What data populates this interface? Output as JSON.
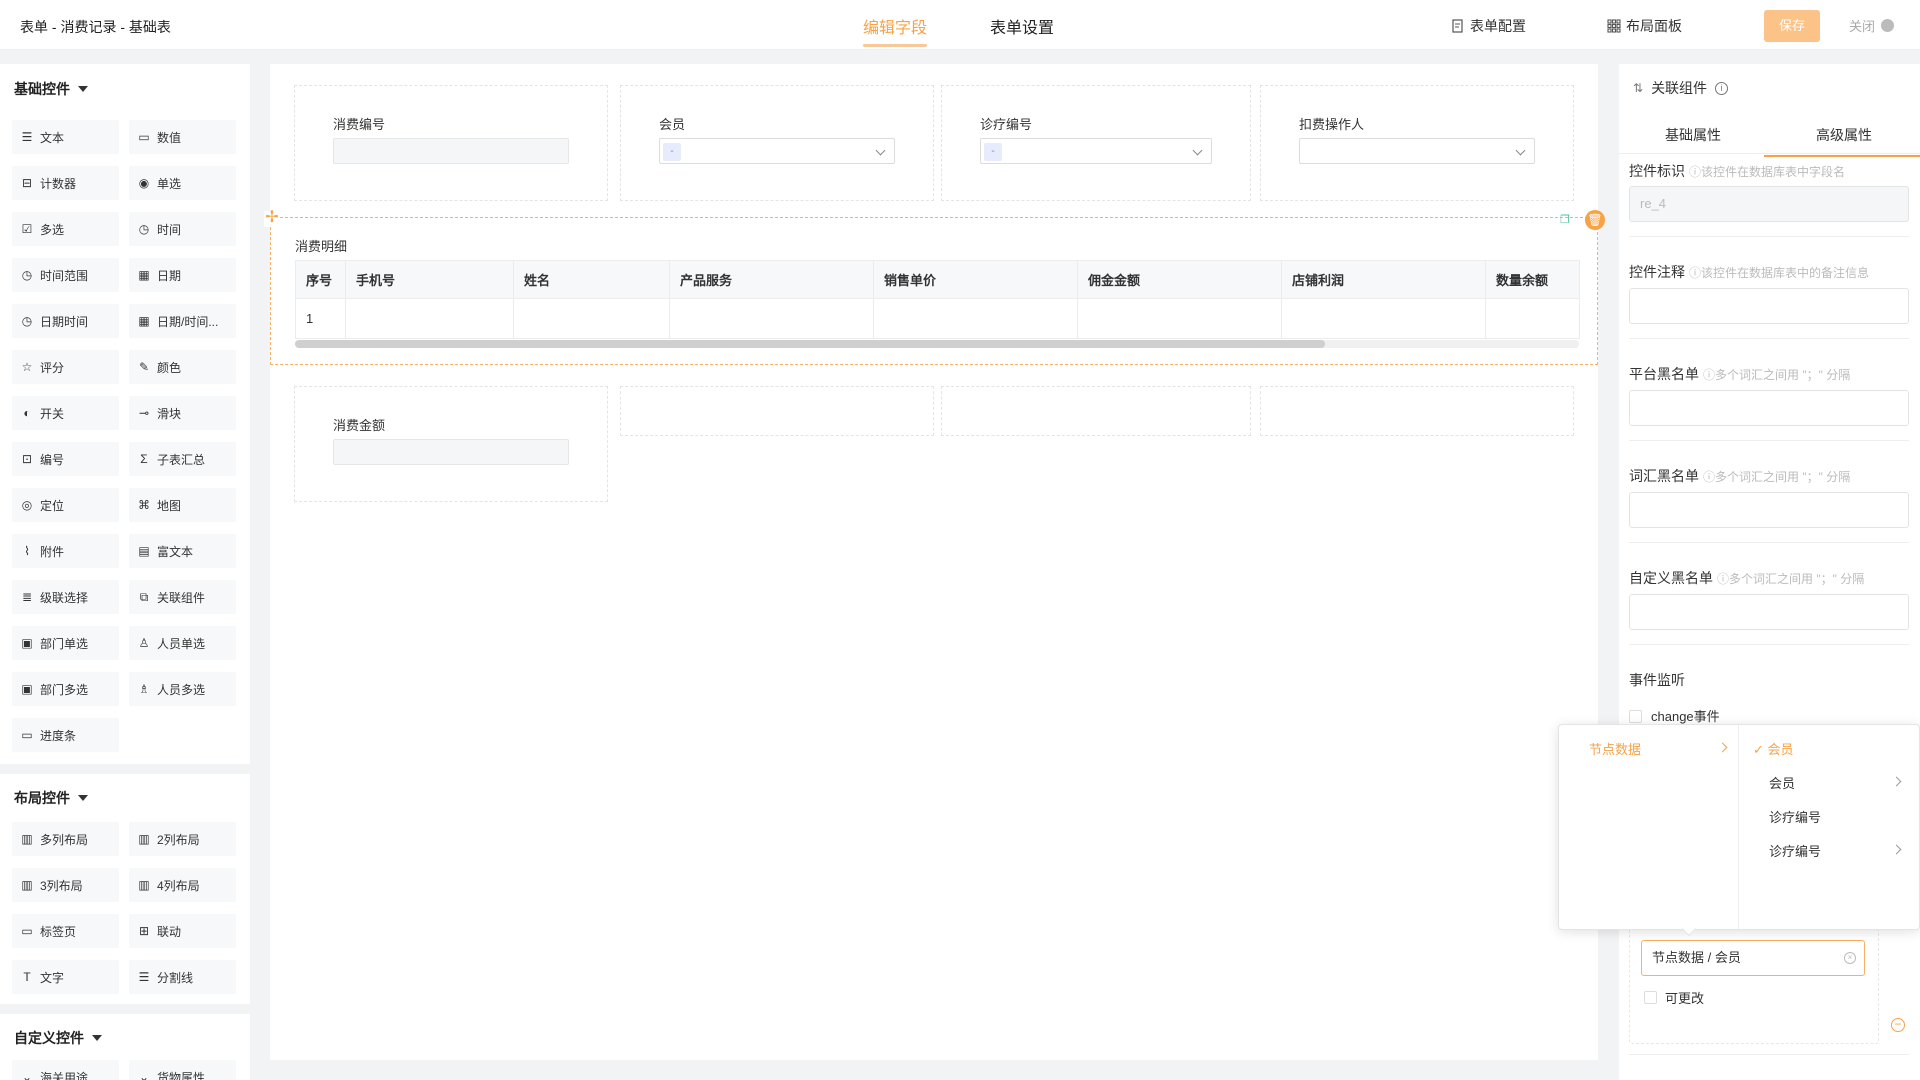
{
  "header": {
    "title": "表单 - 消费记录 - 基础表",
    "tabs": [
      {
        "label": "编辑字段",
        "active": true
      },
      {
        "label": "表单设置",
        "active": false
      }
    ],
    "form_config": "表单配置",
    "layout_panel": "布局面板",
    "save": "保存",
    "close": "关闭"
  },
  "sidebar": {
    "basic_title": "基础控件",
    "basic": [
      {
        "label": "文本",
        "icon": "text-icon"
      },
      {
        "label": "数值",
        "icon": "number-icon"
      },
      {
        "label": "计数器",
        "icon": "counter-icon"
      },
      {
        "label": "单选",
        "icon": "radio-icon"
      },
      {
        "label": "多选",
        "icon": "checkbox-icon"
      },
      {
        "label": "时间",
        "icon": "clock-icon"
      },
      {
        "label": "时间范围",
        "icon": "clock-icon"
      },
      {
        "label": "日期",
        "icon": "calendar-icon"
      },
      {
        "label": "日期时间",
        "icon": "clock-icon"
      },
      {
        "label": "日期/时间...",
        "icon": "calendar-icon"
      },
      {
        "label": "评分",
        "icon": "star-icon"
      },
      {
        "label": "颜色",
        "icon": "pen-icon"
      },
      {
        "label": "开关",
        "icon": "switch-icon"
      },
      {
        "label": "滑块",
        "icon": "slider-icon"
      },
      {
        "label": "编号",
        "icon": "serial-icon"
      },
      {
        "label": "子表汇总",
        "icon": "sigma-icon"
      },
      {
        "label": "定位",
        "icon": "location-icon"
      },
      {
        "label": "地图",
        "icon": "map-icon"
      },
      {
        "label": "附件",
        "icon": "paperclip-icon"
      },
      {
        "label": "富文本",
        "icon": "richtext-icon"
      },
      {
        "label": "级联选择",
        "icon": "cascade-icon"
      },
      {
        "label": "关联组件",
        "icon": "link-icon"
      },
      {
        "label": "部门单选",
        "icon": "department-icon"
      },
      {
        "label": "人员单选",
        "icon": "user-icon"
      },
      {
        "label": "部门多选",
        "icon": "department-icon"
      },
      {
        "label": "人员多选",
        "icon": "users-icon"
      },
      {
        "label": "进度条",
        "icon": "progress-icon"
      }
    ],
    "layout_title": "布局控件",
    "layout": [
      {
        "label": "多列布局",
        "icon": "columns-icon"
      },
      {
        "label": "2列布局",
        "icon": "columns-icon"
      },
      {
        "label": "3列布局",
        "icon": "columns-icon"
      },
      {
        "label": "4列布局",
        "icon": "columns-icon"
      },
      {
        "label": "标签页",
        "icon": "tab-icon"
      },
      {
        "label": "联动",
        "icon": "grid-icon"
      },
      {
        "label": "文字",
        "icon": "text-t-icon"
      },
      {
        "label": "分割线",
        "icon": "divider-icon"
      }
    ],
    "custom_title": "自定义控件",
    "custom": [
      {
        "label": "海关用途",
        "icon": "custom-icon"
      },
      {
        "label": "货物属性",
        "icon": "custom-icon"
      }
    ]
  },
  "form": {
    "row1": [
      {
        "label": "消费编号",
        "kind": "input"
      },
      {
        "label": "会员",
        "kind": "select-tag",
        "tag": "-"
      },
      {
        "label": "诊疗编号",
        "kind": "select-tag",
        "tag": "-"
      },
      {
        "label": "扣费操作人",
        "kind": "select"
      }
    ],
    "subtable": {
      "title": "消费明细",
      "columns": [
        "序号",
        "手机号",
        "姓名",
        "产品服务",
        "销售单价",
        "佣金金额",
        "店铺利润",
        "数量余额"
      ],
      "rows": [
        [
          "1",
          "",
          "",
          "",
          "",
          "",
          "",
          ""
        ]
      ]
    },
    "row3": [
      {
        "label": "消费金额",
        "kind": "input"
      }
    ]
  },
  "panel": {
    "title": "关联组件",
    "tabs": [
      {
        "label": "基础属性",
        "active": false
      },
      {
        "label": "高级属性",
        "active": true
      }
    ],
    "field_id_label": "控件标识",
    "field_id_hint": "ⓘ该控件在数据库表中字段名",
    "field_id_value": "re_4",
    "comment_label": "控件注释",
    "comment_hint": "ⓘ该控件在数据库表中的备注信息",
    "platform_black_label": "平台黑名单",
    "black_hint": "ⓘ多个词汇之间用 \"；\" 分隔",
    "word_black_label": "词汇黑名单",
    "custom_black_label": "自定义黑名单",
    "event_label": "事件监听",
    "change_event": "change事件",
    "cascade_value": "节点数据 / 会员",
    "editable_label": "可更改"
  },
  "cascader": {
    "col1": [
      {
        "label": "节点数据",
        "active": true
      }
    ],
    "col2": [
      {
        "label": "会员",
        "active": true,
        "checked": true,
        "has_children": false
      },
      {
        "label": "会员",
        "active": false,
        "checked": false,
        "has_children": true
      },
      {
        "label": "诊疗编号",
        "active": false,
        "checked": false,
        "has_children": false
      },
      {
        "label": "诊疗编号",
        "active": false,
        "checked": false,
        "has_children": true
      }
    ]
  },
  "colors": {
    "accent": "#f7a246",
    "save_bg": "#fcc389"
  }
}
